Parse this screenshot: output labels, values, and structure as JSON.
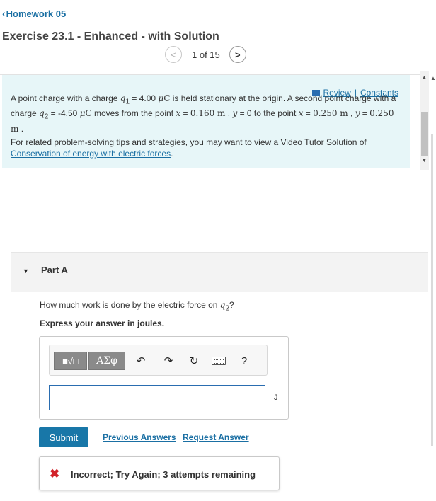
{
  "nav": {
    "back_label": "Homework 05"
  },
  "exercise": {
    "title": "Exercise 23.1 - Enhanced - with Solution"
  },
  "pager": {
    "text": "1 of 15",
    "prev": "<",
    "next": ">"
  },
  "links": {
    "review": "Review",
    "separator": "|",
    "constants": "Constants"
  },
  "problem": {
    "intro": "A point charge with a charge",
    "q1_sym": "q",
    "q1_sub": "1",
    "q1_eq": " = 4.00",
    "mu": "μ",
    "unit_c": "C",
    "mid1": " is held stationary at the origin. A second point charge with a charge",
    "q2_sym": "q",
    "q2_sub": "2",
    "q2_eq": " = -4.50",
    "mid2": " moves from the point",
    "x_sym": "x",
    "eq": " = ",
    "x1_val": "0.160",
    "m": " m",
    "comma": " , ",
    "y_sym": "y",
    "y1_val": " = 0 to the point",
    "x2_val": "0.250",
    "y2_val": "0.250",
    "end": " .",
    "related_text": "For related problem-solving tips and strategies, you may want to view a Video Tutor Solution of ",
    "related_link": "Conservation of energy with electric forces",
    "related_end": "."
  },
  "part": {
    "caret": "▼",
    "label": "Part A",
    "question_prefix": "How much work is done by the electric force on ",
    "question_sym": "q",
    "question_sub": "2",
    "question_suffix": "?",
    "instruction": "Express your answer in joules."
  },
  "toolbar": {
    "template_label": "■√□",
    "symbols_label": "ΑΣφ",
    "undo": "↶",
    "redo": "↷",
    "reset": "↻",
    "keyboard": "keyboard-icon",
    "help": "?"
  },
  "answer": {
    "value": "",
    "unit": "J"
  },
  "actions": {
    "submit": "Submit",
    "previous_answers": "Previous Answers",
    "request_answer": "Request Answer"
  },
  "feedback": {
    "icon": "✖",
    "text": "Incorrect; Try Again; 3 attempts remaining"
  },
  "scroll": {
    "up": "▲",
    "down": "▼",
    "outer_up": "▲"
  },
  "colors": {
    "link": "#1a6fa3",
    "problem_bg": "#e7f6f8",
    "submit_bg": "#1877a8",
    "error": "#d2232a"
  }
}
